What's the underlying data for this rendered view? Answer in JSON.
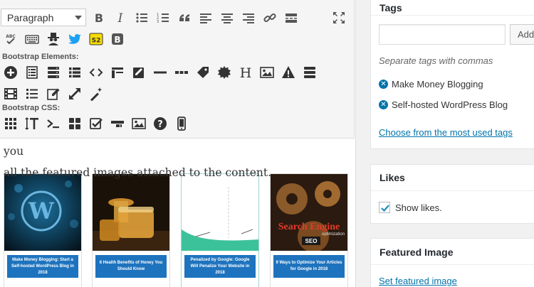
{
  "editor": {
    "format_select": "Paragraph",
    "section_bootstrap_elements": "Bootstrap Elements:",
    "section_bootstrap_css": "Bootstrap CSS:",
    "s2_badge": "S2",
    "b_badge": "B",
    "heading_glyph": "H",
    "help_glyph": "?",
    "spell_glyph": "ABC",
    "content_line1": "home pages. For example in my blog, my home page will show you",
    "content_line2": "all the featured images attached to the content.",
    "thumbnails": [
      {
        "caption": "Make Money Blogging: Start a Self-hosted WordPress Blog in 2018"
      },
      {
        "caption": "6 Health Benefits of Honey You Should Know"
      },
      {
        "caption": "Penalized by Google: Google Will Penalize Your Website in 2018"
      },
      {
        "caption": "9 Ways to Optimize Your Articles for Google in 2018"
      }
    ],
    "thumb4_overlay": "Search Engine",
    "thumb4_overlay_sub": "optimization",
    "thumb4_seo": "SEO"
  },
  "sidebar": {
    "tags": {
      "title": "Tags",
      "add_button": "Add",
      "help": "Separate tags with commas",
      "items": [
        "Make Money Blogging",
        "Self-hosted WordPress Blog"
      ],
      "choose_link": "Choose from the most used tags"
    },
    "likes": {
      "title": "Likes",
      "checkbox_label": "Show likes.",
      "checked": true
    },
    "featured": {
      "title": "Featured Image",
      "set_link": "Set featured image"
    }
  },
  "colors": {
    "accent": "#0073aa",
    "twitter": "#1da1f2",
    "s2_yellow": "#f7dc00",
    "caption_blue": "#1e73be"
  }
}
